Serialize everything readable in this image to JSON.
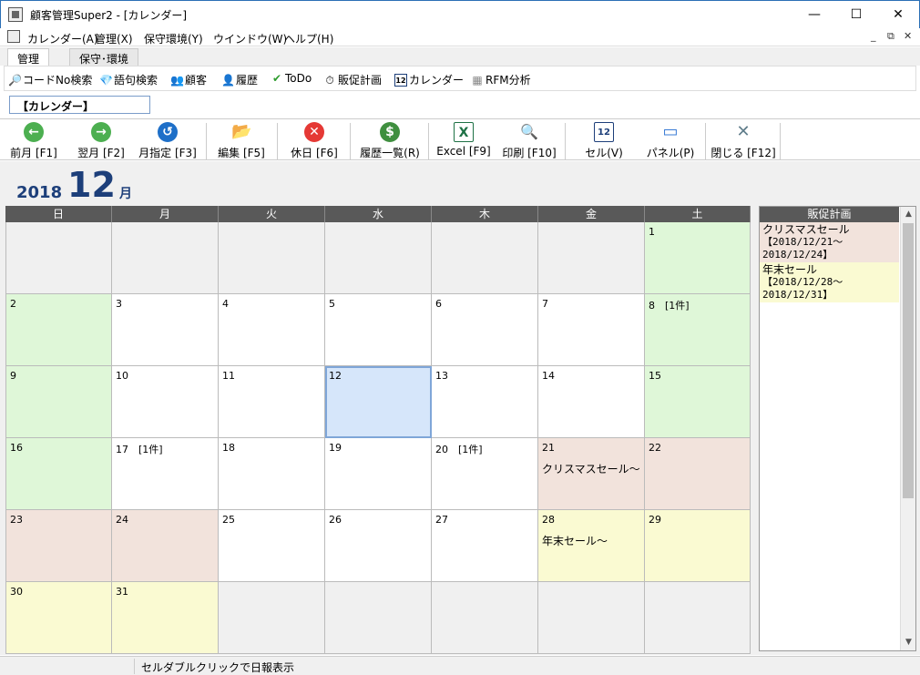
{
  "window": {
    "title": "顧客管理Super2 - [カレンダー]",
    "min": "—",
    "max": "☐",
    "close": "✕"
  },
  "menu": [
    "カレンダー(A)",
    "管理(X)",
    "保守環境(Y)",
    "ウインドウ(W)",
    "ヘルプ(H)"
  ],
  "mdi_controls": [
    "_",
    "⧉",
    "✕"
  ],
  "tabs": [
    "管理",
    "保守･環境"
  ],
  "toolbar1": [
    {
      "icon": "magnifier-icon",
      "glyph": "🔎",
      "label": "コードNo検索"
    },
    {
      "icon": "diamond-icon",
      "glyph": "💎",
      "label": "語句検索"
    },
    {
      "icon": "customers-icon",
      "glyph": "👥",
      "label": "顧客"
    },
    {
      "icon": "history-icon",
      "glyph": "👤",
      "label": "履歴"
    },
    {
      "icon": "check-icon",
      "glyph": "✔",
      "label": "ToDo"
    },
    {
      "icon": "stopwatch-icon",
      "glyph": "⏱",
      "label": "販促計画"
    },
    {
      "icon": "calendar-icon",
      "glyph": "12",
      "label": "カレンダー"
    },
    {
      "icon": "grid-icon",
      "glyph": "▦",
      "label": "RFM分析"
    }
  ],
  "section_title": "【カレンダー】",
  "toolbar2": [
    {
      "icon": "prev-month-icon",
      "glyph": "←",
      "color": "#4caf50",
      "label": "前月 [F1]"
    },
    {
      "icon": "next-month-icon",
      "glyph": "→",
      "color": "#4caf50",
      "label": "翌月 [F2]"
    },
    {
      "icon": "month-select-icon",
      "glyph": "↺",
      "color": "#1e6fc8",
      "label": "月指定 [F3]"
    },
    {
      "icon": "edit-folder-icon",
      "glyph": "📂",
      "color": "#f4c542",
      "label": "編集 [F5]"
    },
    {
      "icon": "holiday-icon",
      "glyph": "✕",
      "color": "#e53935",
      "label": "休日 [F6]"
    },
    {
      "icon": "history-list-icon",
      "glyph": "$",
      "color": "#3f8f3f",
      "label": "履歴一覧(R)"
    },
    {
      "icon": "excel-icon",
      "glyph": "X",
      "color": "#1e7145",
      "label": "Excel [F9]"
    },
    {
      "icon": "print-icon",
      "glyph": "🔍",
      "color": "#5a8fd8",
      "label": "印刷 [F10]"
    },
    {
      "icon": "cell-icon",
      "glyph": "12",
      "color": "#1d3f7a",
      "label": "セル(V)"
    },
    {
      "icon": "panel-icon",
      "glyph": "▭",
      "color": "#3a7bd5",
      "label": "パネル(P)"
    },
    {
      "icon": "close-x-icon",
      "glyph": "✕",
      "color": "#607d8b",
      "label": "閉じる [F12]"
    }
  ],
  "calendar": {
    "year": "2018",
    "month": "12",
    "month_suffix": "月",
    "weekdays": [
      "日",
      "月",
      "火",
      "水",
      "木",
      "金",
      "土"
    ],
    "weeks": [
      [
        {
          "d": ""
        },
        {
          "d": ""
        },
        {
          "d": ""
        },
        {
          "d": ""
        },
        {
          "d": ""
        },
        {
          "d": ""
        },
        {
          "d": "1",
          "bg": "#dff7d8"
        }
      ],
      [
        {
          "d": "2",
          "bg": "#dff7d8"
        },
        {
          "d": "3"
        },
        {
          "d": "4"
        },
        {
          "d": "5"
        },
        {
          "d": "6"
        },
        {
          "d": "7"
        },
        {
          "d": "8　[1件]",
          "bg": "#dff7d8"
        }
      ],
      [
        {
          "d": "9",
          "bg": "#dff7d8"
        },
        {
          "d": "10"
        },
        {
          "d": "11"
        },
        {
          "d": "12",
          "bg": "#d6e6fa",
          "selected": true
        },
        {
          "d": "13"
        },
        {
          "d": "14"
        },
        {
          "d": "15",
          "bg": "#dff7d8"
        }
      ],
      [
        {
          "d": "16",
          "bg": "#dff7d8"
        },
        {
          "d": "17　[1件]"
        },
        {
          "d": "18"
        },
        {
          "d": "19"
        },
        {
          "d": "20　[1件]"
        },
        {
          "d": "21",
          "bg": "#f2e3dc",
          "extra": "クリスマスセール～"
        },
        {
          "d": "22",
          "bg": "#f2e3dc"
        }
      ],
      [
        {
          "d": "23",
          "bg": "#f2e3dc"
        },
        {
          "d": "24",
          "bg": "#f2e3dc"
        },
        {
          "d": "25"
        },
        {
          "d": "26"
        },
        {
          "d": "27"
        },
        {
          "d": "28",
          "bg": "#fafad2",
          "extra": "年末セール～"
        },
        {
          "d": "29",
          "bg": "#fafad2"
        }
      ],
      [
        {
          "d": "30",
          "bg": "#fafad2"
        },
        {
          "d": "31",
          "bg": "#fafad2"
        },
        {
          "d": ""
        },
        {
          "d": ""
        },
        {
          "d": ""
        },
        {
          "d": ""
        },
        {
          "d": ""
        }
      ]
    ]
  },
  "side_panel": {
    "title": "販促計画",
    "items": [
      {
        "name": "クリスマスセール",
        "dates": "【2018/12/21～2018/12/24】",
        "bg": "#f2e3dc"
      },
      {
        "name": "年末セール",
        "dates": "【2018/12/28～2018/12/31】",
        "bg": "#fafad2"
      }
    ]
  },
  "status": {
    "text": "セルダブルクリックで日報表示"
  },
  "colors": {
    "accent": "#1d3f7a",
    "header_bg": "#595959",
    "empty_cell": "#f0f0f0",
    "weekday_cell": "#ffffff"
  }
}
